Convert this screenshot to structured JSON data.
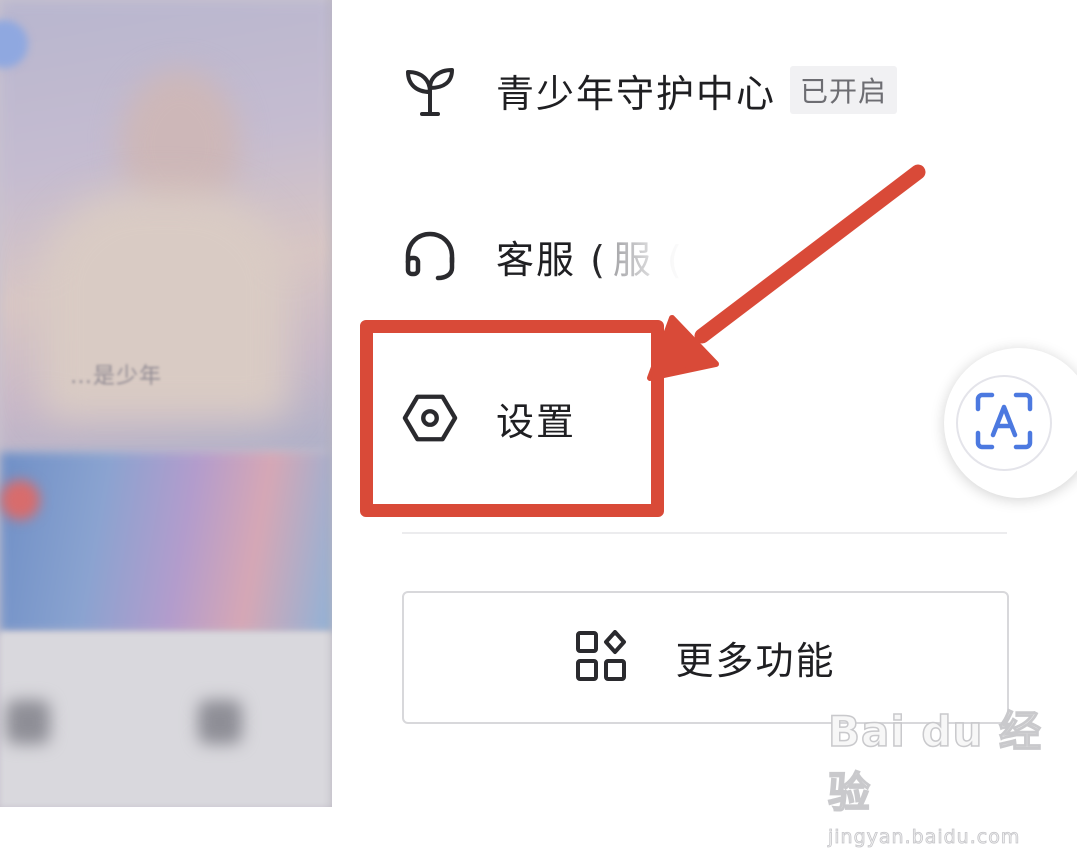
{
  "background": {
    "caption": "…是少年"
  },
  "menu": {
    "items": [
      {
        "label": "青少年守护中心",
        "badge": "已开启",
        "icon": "sprout-icon"
      },
      {
        "label": "客服 (",
        "label_faded": "服 (",
        "icon": "headset-icon"
      },
      {
        "label": "设置",
        "icon": "settings-hexagon-icon"
      }
    ],
    "more_button": {
      "label": "更多功能",
      "icon": "apps-grid-icon"
    }
  },
  "floating_button": {
    "icon": "text-recognition-icon",
    "glyph": "A"
  },
  "annotation": {
    "color": "#d94a38",
    "target": "设置"
  },
  "watermark": {
    "logo": "Bai du 经验",
    "url": "jingyan.baidu.com"
  }
}
